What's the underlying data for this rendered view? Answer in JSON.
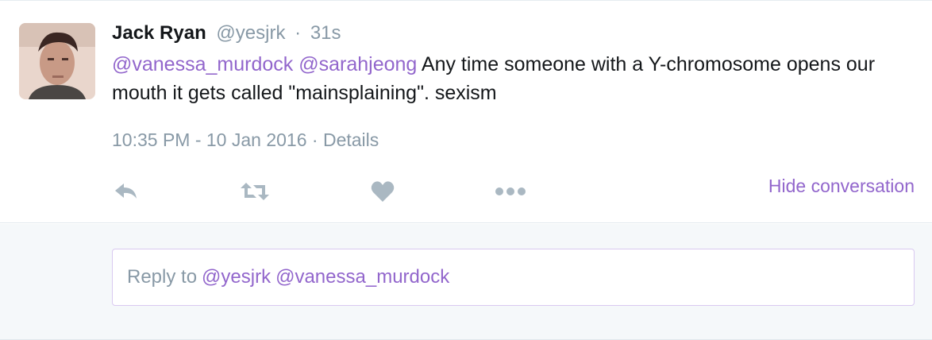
{
  "tweet": {
    "author_name": "Jack Ryan",
    "author_handle": "@yesjrk",
    "separator": "·",
    "age": "31s",
    "text_mention_1": "@vanessa_murdock",
    "text_mention_2": "@sarahjeong",
    "text_body": "Any time someone with a Y-chromosome opens our mouth it gets called \"mainsplaining\". sexism",
    "timestamp": "10:35 PM - 10 Jan 2016",
    "details_label": "Details",
    "hide_conversation_label": "Hide conversation"
  },
  "actions": {
    "reply_icon": "reply-icon",
    "retweet_icon": "retweet-icon",
    "like_icon": "heart-icon",
    "more_icon": "more-dots-icon"
  },
  "reply": {
    "placeholder_prefix": "Reply to",
    "mention_1": "@yesjrk",
    "mention_2": "@vanessa_murdock"
  },
  "colors": {
    "accent": "#9266cc",
    "muted": "#8899a6",
    "text": "#14171a",
    "reply_bg": "#f5f8fa"
  }
}
